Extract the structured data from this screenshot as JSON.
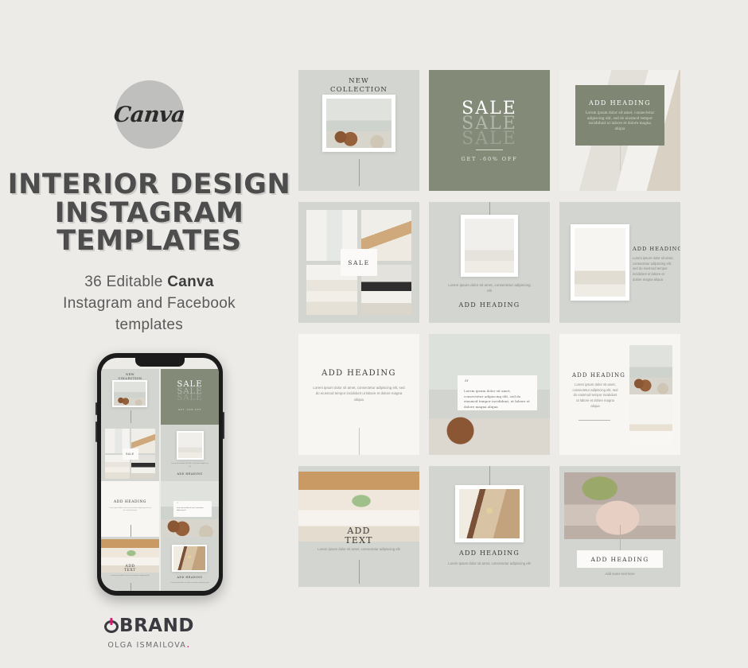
{
  "brand_badge": {
    "label": "Canva"
  },
  "headline": {
    "line1": "INTERIOR DESIGN",
    "line2": "INSTAGRAM",
    "line3": "TEMPLATES"
  },
  "subhead": {
    "count_prefix": "36 Editable ",
    "count_brand": "Canva",
    "line2": "Instagram and Facebook",
    "line3": "templates"
  },
  "footer_logo": {
    "main": "BRAND",
    "sub": "OLGA ISMAILOVA",
    "dot": "."
  },
  "colors": {
    "page_bg": "#ecebe7",
    "card_bg": "#d2d5d0",
    "accent_green": "#838a78",
    "heading_gray": "#4d4d4d",
    "brand_pink": "#d6186f",
    "white_card": "#f7f6f3"
  },
  "lorem": {
    "short": "Lorem ipsum dolor sit amet, consectetur adipiscing elit.",
    "medium": "Lorem ipsum dolor sit amet, consectetur adipiscing elit, sed do eiusmod tempor incididunt ut labore et dolore magna aliqua.",
    "quote": "Lorem ipsum dolor sit amet, consectetur adipiscing elit, sed do eiusmod tempor incididunt, ut labore et dolore magna aliqua."
  },
  "templates": [
    {
      "id": 1,
      "name": "new-collection",
      "title_l1": "NEW",
      "title_l2": "COLLECTION"
    },
    {
      "id": 2,
      "name": "sale-green",
      "sale1": "SALE",
      "sale2": "SALE",
      "sale3": "SALE",
      "offer": "GET -60% OFF"
    },
    {
      "id": 3,
      "name": "kitchen-overlay",
      "heading": "ADD HEADING",
      "body": "Lorem ipsum dolor sit amet, consectetur adipiscing elit, sed do eiusmod tempor incididunt ut labore et dolore magna aliqua"
    },
    {
      "id": 4,
      "name": "collage-sale",
      "badge": "SALE"
    },
    {
      "id": 5,
      "name": "portrait-heading",
      "body": "Lorem ipsum dolor sit amet, consectetur adipiscing elit",
      "heading": "ADD HEADING"
    },
    {
      "id": 6,
      "name": "left-photo-right-text",
      "heading": "ADD HEADING",
      "body": "Lorem ipsum dolor sit amet, consectetur adipiscing elit, sed do eiusmod tempor incididunt ut labore et dolore magna aliqua"
    },
    {
      "id": 7,
      "name": "text-only-white",
      "heading": "ADD HEADING",
      "body": "Lorem ipsum dolor sit amet, consectetur adipiscing elit, sed do eiusmod tempor incididunt ut labore et dolore magna aliqua"
    },
    {
      "id": 8,
      "name": "photo-quote",
      "quote_mark": "“",
      "body": "Lorem ipsum dolor sit amet, consectetur adipiscing elit, sed do eiusmod tempor incididunt, ut labore et dolore magna aliqua"
    },
    {
      "id": 9,
      "name": "text-left-stacked-photos",
      "heading": "ADD HEADING",
      "body": "Lorem ipsum dolor sit amet, consectetur adipiscing elit, sed do eiusmod tempor incididunt ut labore et dolore magna aliqua"
    },
    {
      "id": 10,
      "name": "kitchen-add-text",
      "title_l1": "ADD",
      "title_l2": "TEXT",
      "body": "Lorem ipsum dolor sit amet, consectetur adipiscing elit"
    },
    {
      "id": 11,
      "name": "dining-heading",
      "heading": "ADD HEADING",
      "body": "Lorem ipsum dolor sit amet, consectetur adipiscing elit"
    },
    {
      "id": 12,
      "name": "bath-heading-box",
      "heading": "ADD HEADING",
      "body": "Add some text here"
    }
  ],
  "phone_preview": {
    "name": "instagram-feed-mockup",
    "tiles": [
      "new-collection",
      "sale-green",
      "collage-sale",
      "portrait-heading",
      "text-only-white",
      "photo-quote",
      "kitchen-add-text",
      "dining-heading"
    ],
    "tile_labels": {
      "new1": "NEW",
      "new2": "COLLECTION",
      "sale": "SALE",
      "add_heading": "ADD HEADING",
      "add_text_1": "ADD",
      "add_text_2": "TEXT",
      "collage_badge": "SALE"
    }
  }
}
